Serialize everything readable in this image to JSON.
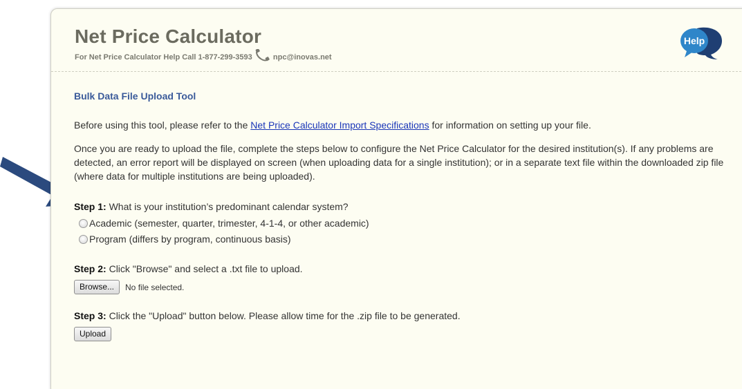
{
  "header": {
    "title": "Net Price Calculator",
    "help_prefix": "For Net Price Calculator Help Call 1-877-299-3593",
    "help_email": "npc@inovas.net",
    "help_badge": "Help"
  },
  "main": {
    "section_title": "Bulk Data File Upload Tool",
    "intro": {
      "before": "Before using this tool, please refer to the ",
      "link": "Net Price Calculator Import Specifications",
      "after": " for information on setting up your file."
    },
    "instructions": "Once you are ready to upload the file, complete the steps below to configure the Net Price Calculator for the desired institution(s). If any problems are detected, an error report will be displayed on screen (when uploading data for a single institution); or in a separate text file within the downloaded zip file (where data for multiple institutions are being uploaded).",
    "step1": {
      "label": "Step 1:",
      "text": " What is your institution’s predominant calendar system?",
      "options": [
        "Academic (semester, quarter, trimester, 4-1-4, or other academic)",
        "Program (differs by program, continuous basis)"
      ]
    },
    "step2": {
      "label": "Step 2:",
      "text": " Click \"Browse\" and select a .txt file to upload.",
      "browse_label": "Browse...",
      "file_status": "No file selected."
    },
    "step3": {
      "label": "Step 3:",
      "text": " Click the \"Upload\" button below. Please allow time for the .zip file to be generated.",
      "upload_label": "Upload"
    }
  },
  "colors": {
    "panel_bg": "#fdfdf2",
    "title_gray": "#6b6b5f",
    "section_blue": "#3a5a9a",
    "link_blue": "#1a36b8",
    "arrow_navy": "#2b4a7e",
    "help_blue": "#2f86c9",
    "help_navy": "#1f3f73"
  },
  "icons": {
    "phone": "phone-icon",
    "help": "help-speech-bubble-icon",
    "arrow": "pointer-arrow-icon"
  }
}
